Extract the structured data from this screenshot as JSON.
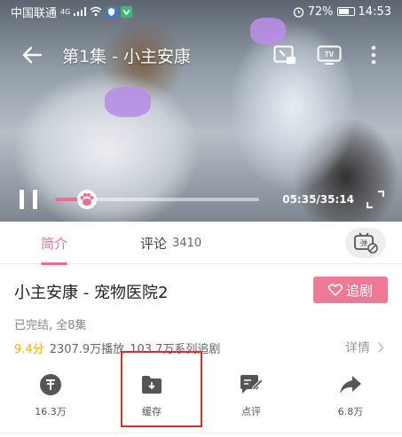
{
  "status_bar": {
    "carrier": "中国联通",
    "network": "4G",
    "battery": "72%",
    "time": "14:53"
  },
  "player": {
    "title": "第1集 - 小主安康",
    "time": "05:35/35:14",
    "progress": 0.158
  },
  "tabs": [
    {
      "label": "简介",
      "active": true
    },
    {
      "label": "评论",
      "count": "3410",
      "active": false
    }
  ],
  "show": {
    "title": "小主安康 - 宠物医院2",
    "follow_label": "追剧",
    "status": "已完结, 全8集",
    "score": "9.4分",
    "plays": "2307.9万播放",
    "followers": "103.7万系列追剧",
    "details_label": "详情"
  },
  "actions": [
    {
      "icon": "coin-icon",
      "label": "16.3万"
    },
    {
      "icon": "download-folder-icon",
      "label": "缓存"
    },
    {
      "icon": "comment-edit-icon",
      "label": "点评"
    },
    {
      "icon": "share-arrow-icon",
      "label": "6.8万"
    }
  ],
  "colors": {
    "accent": "#f06d8d",
    "follow_button": "#f07a95",
    "score": "#f0b400",
    "highlight": "#d3312f"
  }
}
